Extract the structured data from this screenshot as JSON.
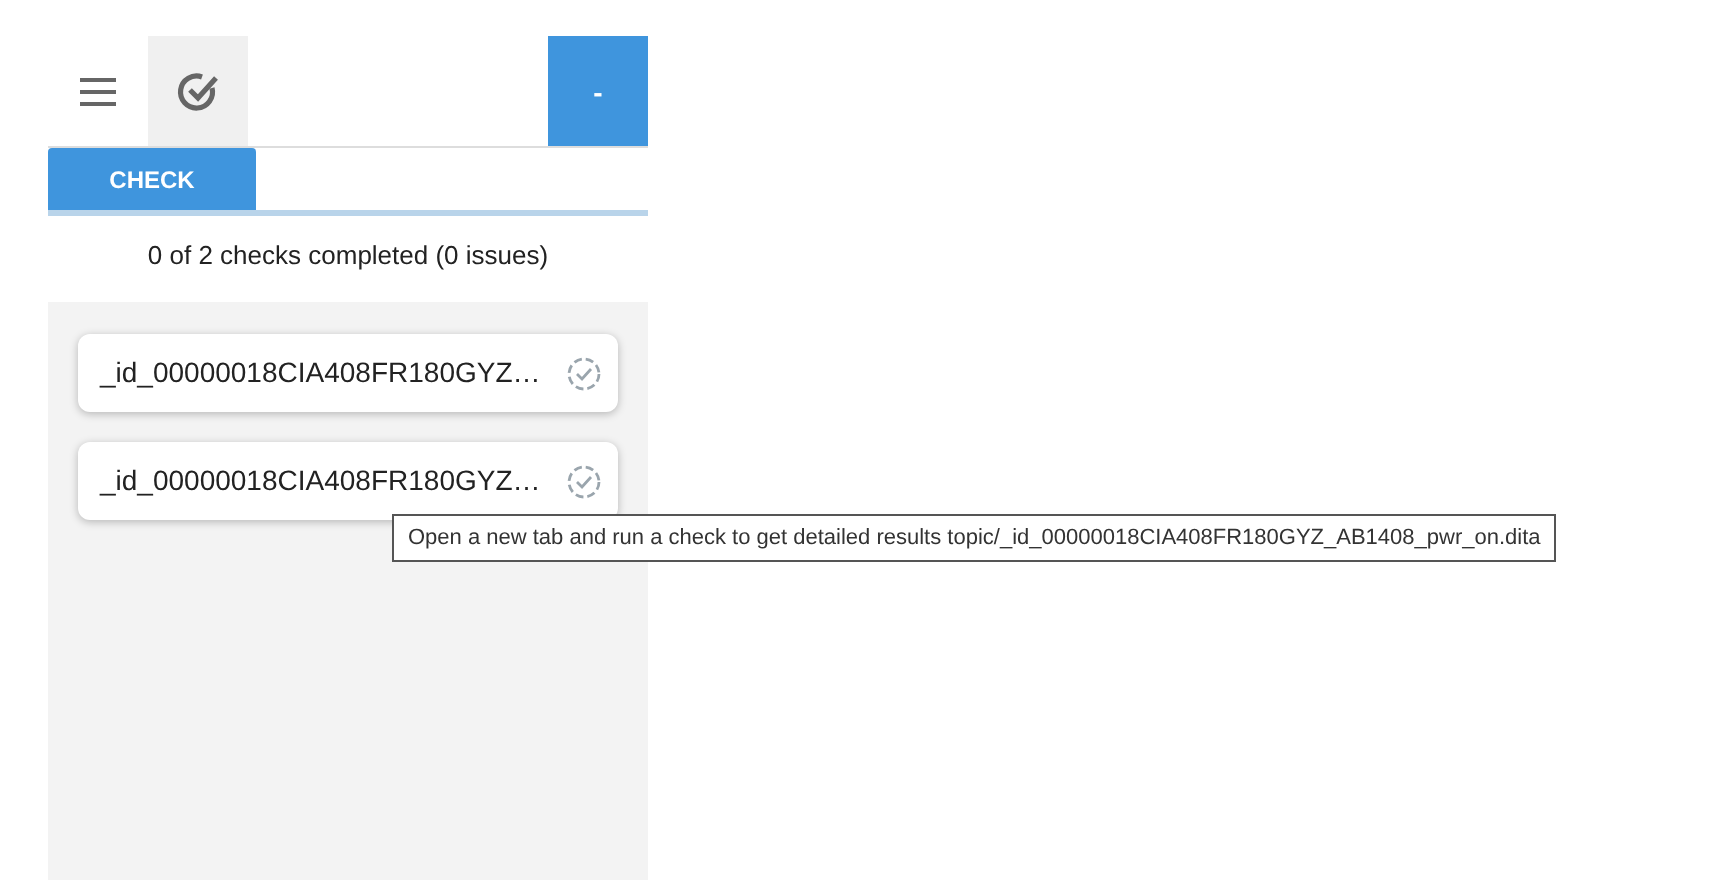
{
  "toolbar": {
    "collapse_button": "-"
  },
  "tabs": [
    {
      "label": "CHECK",
      "selected": true
    }
  ],
  "summary": "0 of 2 checks completed (0 issues)",
  "checks": [
    {
      "name": "_id_00000018CIA408FR180GYZ…"
    },
    {
      "name": "_id_00000018CIA408FR180GYZ…"
    }
  ],
  "tooltip": "Open a new tab and run a check to get detailed results topic/_id_00000018CIA408FR180GYZ_AB1408_pwr_on.dita"
}
